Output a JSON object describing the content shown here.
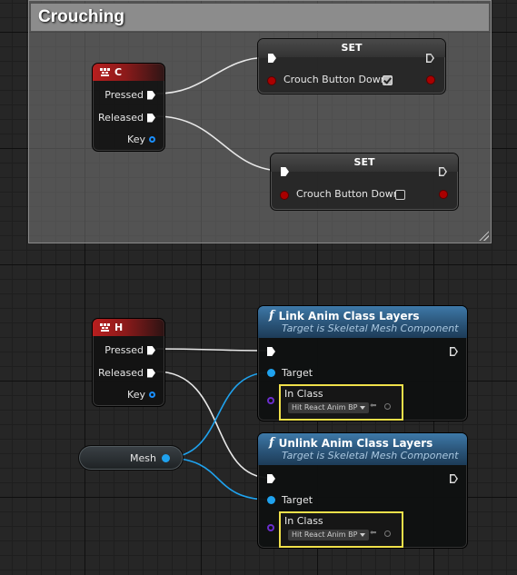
{
  "comment": {
    "title": "Crouching"
  },
  "event_c": {
    "key": "C",
    "pressed": "Pressed",
    "released": "Released",
    "key_label": "Key"
  },
  "event_h": {
    "key": "H",
    "pressed": "Pressed",
    "released": "Released",
    "key_label": "Key"
  },
  "set_true": {
    "title": "SET",
    "variable": "Crouch Button Down",
    "checked": true
  },
  "set_false": {
    "title": "SET",
    "variable": "Crouch Button Down",
    "checked": false
  },
  "link": {
    "title": "Link Anim Class Layers",
    "subtitle": "Target is Skeletal Mesh Component",
    "target_label": "Target",
    "class_label": "In Class",
    "class_value": "Hit React Anim BP"
  },
  "unlink": {
    "title": "Unlink Anim Class Layers",
    "subtitle": "Target is Skeletal Mesh Component",
    "target_label": "Target",
    "class_label": "In Class",
    "class_value": "Hit React Anim BP"
  },
  "mesh": {
    "label": "Mesh"
  },
  "colors": {
    "exec_wire": "#ffffff",
    "object_wire": "#1fa2ee",
    "event_header": "#b81f1f",
    "function_header": "#3e79a8",
    "class_border": "#f0e04a"
  }
}
